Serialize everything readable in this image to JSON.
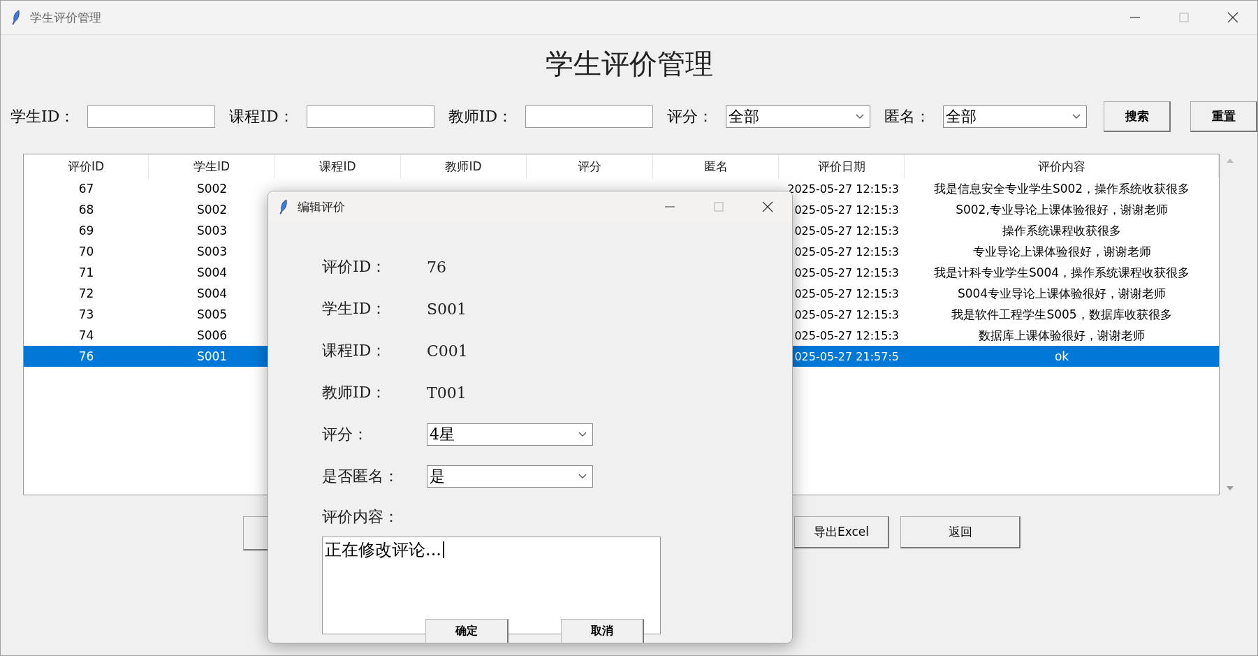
{
  "window": {
    "title": "学生评价管理"
  },
  "heading": "学生评价管理",
  "filters": [
    {
      "kind": "text",
      "label": "学生ID："
    },
    {
      "kind": "text",
      "label": "课程ID："
    },
    {
      "kind": "text",
      "label": "教师ID："
    },
    {
      "kind": "combo",
      "label": "评分：",
      "value": "全部"
    },
    {
      "kind": "combo",
      "label": "匿名：",
      "value": "全部"
    }
  ],
  "filter_buttons": [
    "搜索",
    "重置"
  ],
  "table": {
    "columns": [
      "评价ID",
      "学生ID",
      "课程ID",
      "教师ID",
      "评分",
      "匿名",
      "评价日期",
      "评价内容"
    ],
    "rows": [
      {
        "cells": [
          "67",
          "S002",
          null,
          null,
          null,
          null,
          "2025-05-27 12:15:3",
          "我是信息安全专业学生S002，操作系统收获很多"
        ],
        "selected": false
      },
      {
        "cells": [
          "68",
          "S002",
          null,
          null,
          null,
          null,
          "025-05-27 12:15:3",
          "S002,专业导论上课体验很好，谢谢老师"
        ],
        "selected": false
      },
      {
        "cells": [
          "69",
          "S003",
          null,
          null,
          null,
          null,
          "025-05-27 12:15:3",
          "操作系统课程收获很多"
        ],
        "selected": false
      },
      {
        "cells": [
          "70",
          "S003",
          null,
          null,
          null,
          null,
          "025-05-27 12:15:3",
          "专业导论上课体验很好，谢谢老师"
        ],
        "selected": false
      },
      {
        "cells": [
          "71",
          "S004",
          null,
          null,
          null,
          null,
          "025-05-27 12:15:3",
          "我是计科专业学生S004，操作系统课程收获很多"
        ],
        "selected": false
      },
      {
        "cells": [
          "72",
          "S004",
          null,
          null,
          null,
          null,
          "025-05-27 12:15:3",
          "S004专业导论上课体验很好，谢谢老师"
        ],
        "selected": false
      },
      {
        "cells": [
          "73",
          "S005",
          null,
          null,
          null,
          null,
          "025-05-27 12:15:3",
          "我是软件工程学生S005，数据库收获很多"
        ],
        "selected": false
      },
      {
        "cells": [
          "74",
          "S006",
          null,
          null,
          null,
          null,
          "025-05-27 12:15:3",
          "数据库上课体验很好，谢谢老师"
        ],
        "selected": false
      },
      {
        "cells": [
          "76",
          "S001",
          null,
          null,
          null,
          null,
          "025-05-27 21:57:5",
          "ok"
        ],
        "selected": true
      }
    ]
  },
  "actions": [
    "导出Excel",
    "返回"
  ],
  "dialog": {
    "title": "编辑评价",
    "fields": [
      {
        "kind": "text",
        "label": "评价ID：",
        "value": "76"
      },
      {
        "kind": "text",
        "label": "学生ID：",
        "value": "S001"
      },
      {
        "kind": "text",
        "label": "课程ID：",
        "value": "C001"
      },
      {
        "kind": "text",
        "label": "教师ID：",
        "value": "T001"
      },
      {
        "kind": "combo",
        "label": "评分：",
        "value": "4星"
      },
      {
        "kind": "combo",
        "label": "是否匿名：",
        "value": "是"
      }
    ],
    "content_label": "评价内容：",
    "content_value": "正在修改评论...",
    "buttons": [
      "确定",
      "取消"
    ]
  }
}
